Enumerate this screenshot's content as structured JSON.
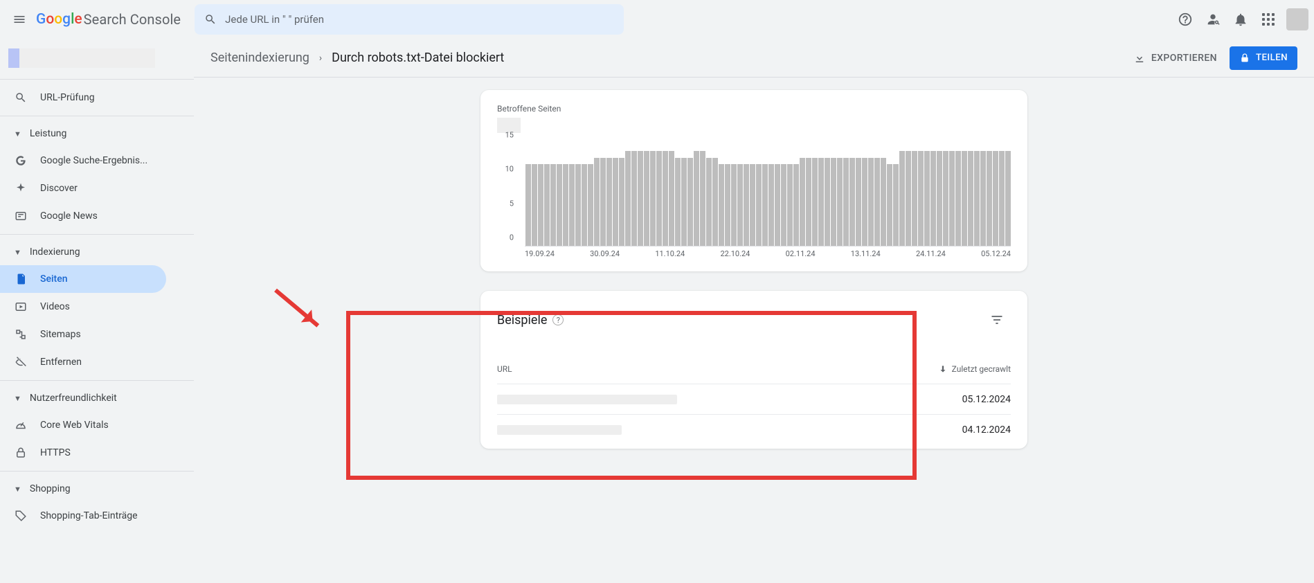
{
  "header": {
    "product_name": "Search Console",
    "search_placeholder": "Jede URL in \"                         \" prüfen"
  },
  "sidebar": {
    "url_check": "URL-Prüfung",
    "sections": {
      "performance": "Leistung",
      "indexing": "Indexierung",
      "experience": "Nutzerfreundlichkeit",
      "shopping": "Shopping"
    },
    "items": {
      "search_results": "Google Suche-Ergebnis...",
      "discover": "Discover",
      "google_news": "Google News",
      "pages": "Seiten",
      "videos": "Videos",
      "sitemaps": "Sitemaps",
      "removals": "Entfernen",
      "cwv": "Core Web Vitals",
      "https": "HTTPS",
      "shopping_tab": "Shopping-Tab-Einträge"
    }
  },
  "breadcrumb": {
    "parent": "Seitenindexierung",
    "current": "Durch robots.txt-Datei blockiert"
  },
  "actions": {
    "export": "EXPORTIEREN",
    "share": "TEILEN"
  },
  "chart_data": {
    "type": "bar",
    "title": "Betroffene Seiten",
    "ylim": [
      0,
      15
    ],
    "yticks": [
      0,
      5,
      10,
      15
    ],
    "xlabels": [
      "19.09.24",
      "30.09.24",
      "11.10.24",
      "22.10.24",
      "02.11.24",
      "13.11.24",
      "24.11.24",
      "05.12.24"
    ],
    "values": [
      12,
      12,
      12,
      12,
      12,
      12,
      12,
      12,
      12,
      12,
      12,
      13,
      13,
      13,
      13,
      13,
      14,
      14,
      14,
      14,
      14,
      14,
      14,
      14,
      13,
      13,
      13,
      14,
      14,
      13,
      13,
      12,
      12,
      12,
      12,
      12,
      12,
      12,
      12,
      12,
      12,
      12,
      12,
      12,
      13,
      13,
      13,
      13,
      13,
      13,
      13,
      13,
      13,
      13,
      13,
      13,
      13,
      13,
      12,
      12,
      14,
      14,
      14,
      14,
      14,
      14,
      14,
      14,
      14,
      14,
      14,
      14,
      14,
      14,
      14,
      14,
      14,
      14
    ]
  },
  "examples": {
    "title": "Beispiele",
    "col_url": "URL",
    "col_crawled": "Zuletzt gecrawlt",
    "rows": [
      {
        "url_width": 260,
        "date": "05.12.2024"
      },
      {
        "url_width": 180,
        "date": "04.12.2024"
      }
    ]
  }
}
